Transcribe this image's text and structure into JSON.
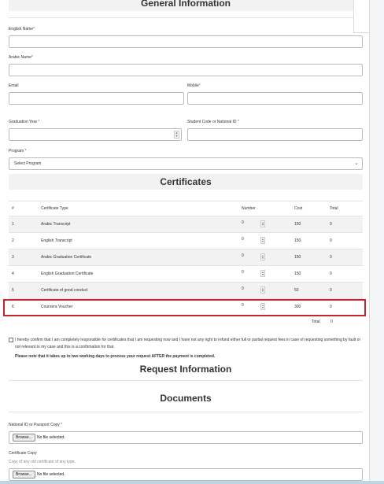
{
  "general": {
    "title": "General Information",
    "english_name_label": "English Name",
    "arabic_name_label": "Arabic Name",
    "email_label": "Email",
    "mobile_label": "Mobile",
    "graduation_year_label": "Graduation Year",
    "student_code_label": "Student Code or National ID",
    "program_label": "Program",
    "program_selected": "Select Program",
    "required_mark": "*"
  },
  "certificates": {
    "title": "Certificates",
    "columns": [
      "#",
      "Certificate Type",
      "Number",
      "Cost",
      "Total"
    ],
    "rows": [
      {
        "index": "1",
        "type": "Arabic Transcript",
        "number": "0",
        "cost": "150",
        "total": "0"
      },
      {
        "index": "2",
        "type": "English Transcript",
        "number": "0",
        "cost": "150",
        "total": "0"
      },
      {
        "index": "3",
        "type": "Arabic Graduation Certificate",
        "number": "0",
        "cost": "150",
        "total": "0"
      },
      {
        "index": "4",
        "type": "English Graduation Certificate",
        "number": "0",
        "cost": "150",
        "total": "0"
      },
      {
        "index": "5",
        "type": "Certificate of good conduct",
        "number": "0",
        "cost": "50",
        "total": "0"
      },
      {
        "index": "6",
        "type": "Coursera Voucher",
        "number": "0",
        "cost": "300",
        "total": "0"
      }
    ],
    "total_label": "Total",
    "total_value": "0"
  },
  "confirmation": {
    "text": "I hereby confirm that I am completely responsible for certificates that I am requesting now and I have not any right to refund either full or partial request fees in case of requesting something by fault or not relevant to my case and this is a confirmation for that.",
    "note": "Please note that it takes up to two working days to process your request AFTER the payment is completed."
  },
  "request": {
    "title": "Request Information"
  },
  "documents": {
    "title": "Documents",
    "national_id_label": "National ID or Passport Copy",
    "certificate_copy_label": "Certificate Copy",
    "certificate_copy_help": "Copy of any old certificate of any type.",
    "browse_label": "Browse...",
    "no_file_text": "No file selected."
  },
  "colors": {
    "highlight": "#c4262e",
    "required": "#c0392b"
  }
}
